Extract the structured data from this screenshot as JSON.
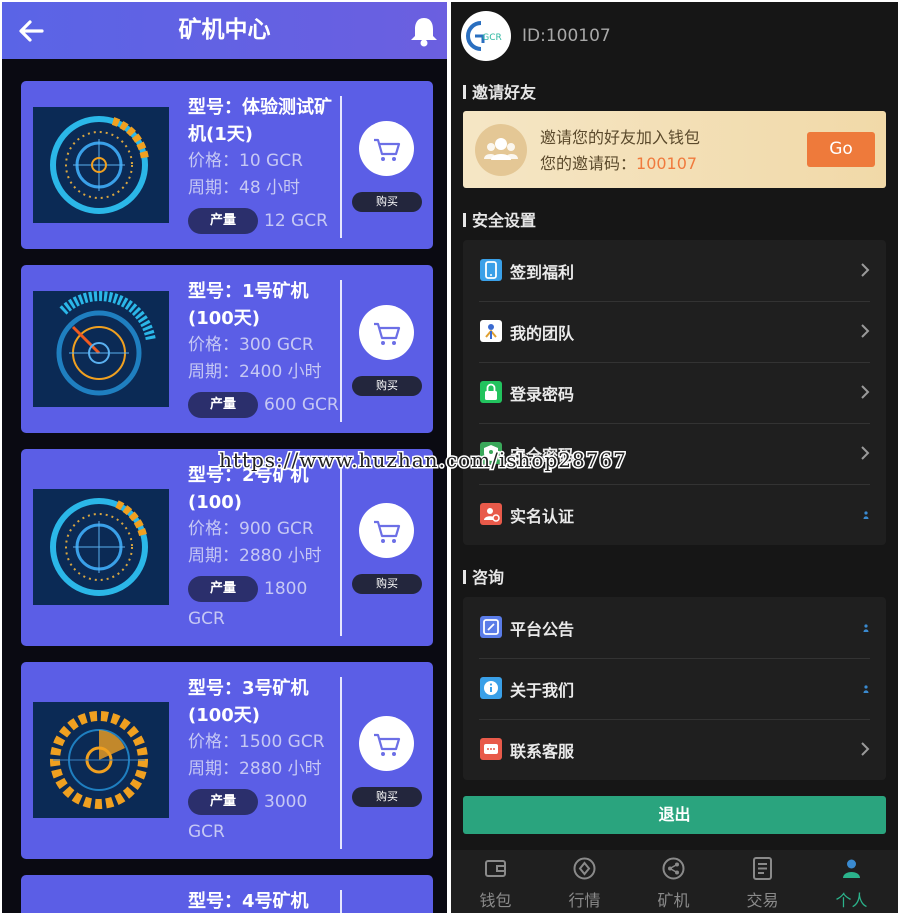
{
  "colors": {
    "header": "#5a64e6",
    "card": "#5b5ee6",
    "accent_green": "#2bb38b",
    "go_orange": "#ee7a3b"
  },
  "miner_center": {
    "title": "矿机中心",
    "yield_label": "产量",
    "buy_label": "购买",
    "cards": [
      {
        "model": "型号：体验测试矿机(1天)",
        "price": "价格：10 GCR",
        "period": "周期：48 小时",
        "yield": "12 GCR"
      },
      {
        "model": "型号：1号矿机(100天)",
        "price": "价格：300 GCR",
        "period": "周期：2400 小时",
        "yield": "600 GCR"
      },
      {
        "model": "型号：2号矿机(100)",
        "price": "价格：900 GCR",
        "period": "周期：2880 小时",
        "yield": "1800 GCR"
      },
      {
        "model": "型号：3号矿机(100天)",
        "price": "价格：1500 GCR",
        "period": "周期：2880 小时",
        "yield": "3000 GCR"
      },
      {
        "model": "型号：4号矿机"
      }
    ]
  },
  "profile": {
    "avatar_text": "GCR",
    "user_id": "ID:100107",
    "invite_section": "邀请好友",
    "invite_line1": "邀请您的好友加入钱包",
    "invite_code_label": "您的邀请码：",
    "invite_code": "100107",
    "go_label": "Go",
    "security_section": "安全设置",
    "security_items": [
      {
        "label": "签到福利",
        "icon": "phone-icon",
        "color": "#3aa0e8"
      },
      {
        "label": "我的团队",
        "icon": "team-icon",
        "color": "#ffffff"
      },
      {
        "label": "登录密码",
        "icon": "lock-icon",
        "color": "#22c35e"
      },
      {
        "label": "安全密码",
        "icon": "shield-icon",
        "color": "#3aa85a"
      },
      {
        "label": "实名认证",
        "icon": "id-verify-icon",
        "color": "#e85a4a"
      }
    ],
    "consult_section": "咨询",
    "consult_items": [
      {
        "label": "平台公告",
        "icon": "announcement-icon",
        "color": "#5a7ce8"
      },
      {
        "label": "关于我们",
        "icon": "info-icon",
        "color": "#3aa0e8"
      },
      {
        "label": "联系客服",
        "icon": "chat-icon",
        "color": "#e85a4a"
      }
    ],
    "logout_label": "退出"
  },
  "tabbar": [
    {
      "label": "钱包",
      "icon": "wallet-icon"
    },
    {
      "label": "行情",
      "icon": "market-icon"
    },
    {
      "label": "矿机",
      "icon": "miner-icon"
    },
    {
      "label": "交易",
      "icon": "trade-icon"
    },
    {
      "label": "个人",
      "icon": "profile-icon",
      "active": true
    }
  ],
  "watermark": "https://www.huzhan.com/ishop28767"
}
